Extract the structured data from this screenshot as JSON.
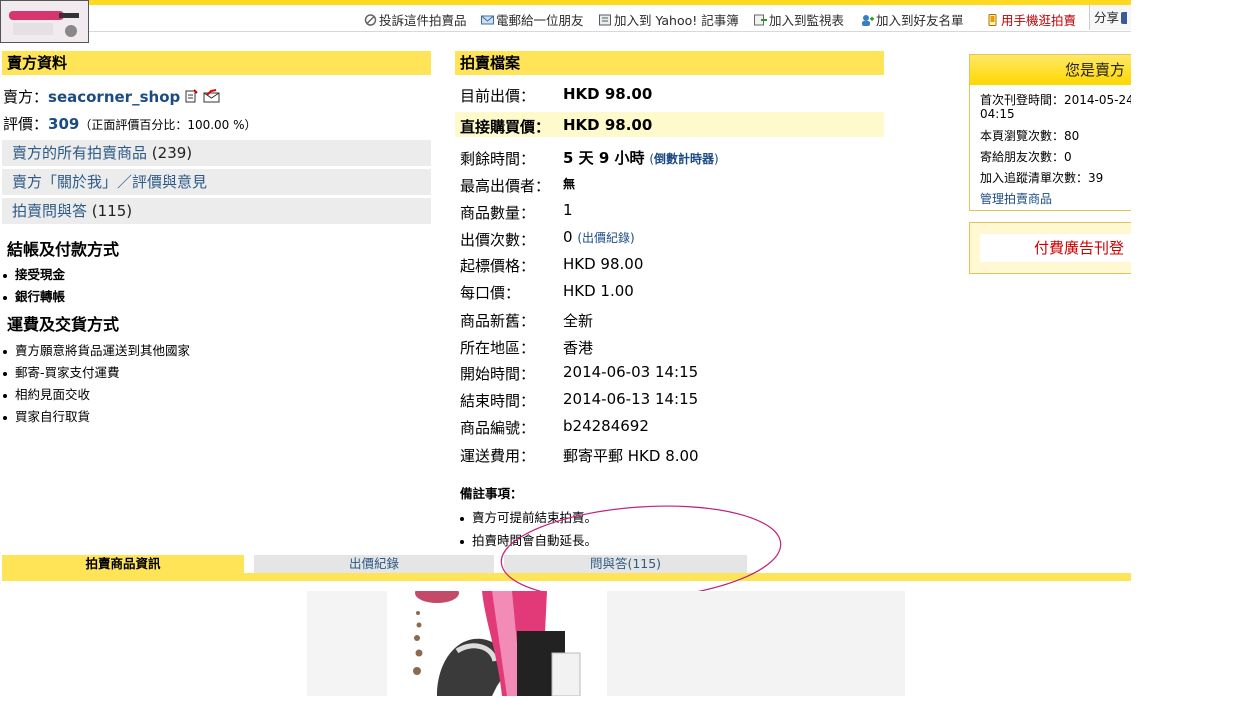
{
  "toolbar": {
    "report": "投訴這件拍賣品",
    "email_friend": "電郵給一位朋友",
    "add_notebook": "加入到 Yahoo! 記事簿",
    "add_watchlist": "加入到監視表",
    "add_friend": "加入到好友名單",
    "mobile_bid": "用手機逛拍賣",
    "share": "分享"
  },
  "seller": {
    "header": "賣方資料",
    "seller_label": "賣方：",
    "seller_name": "seacorner_shop",
    "rating_label": "評價：",
    "rating_value": "309",
    "rating_pct": "（正面評價百分比：100.00 %）",
    "links": [
      {
        "label": "賣方的所有拍賣商品",
        "count": "(239)"
      },
      {
        "label": "賣方「關於我」／評價與意見",
        "count": ""
      },
      {
        "label": "拍賣問與答",
        "count": "(115)"
      }
    ],
    "payment_head": "結帳及付款方式",
    "payment_methods": [
      "接受現金",
      "銀行轉帳"
    ],
    "shipping_head": "運費及交貨方式",
    "shipping_methods": [
      "賣方願意將貨品運送到其他國家",
      "郵寄-買家支付運費",
      "相約見面交收",
      "買家自行取貨"
    ]
  },
  "auction": {
    "header": "拍賣檔案",
    "current_bid_label": "目前出價：",
    "current_bid": "HKD 98.00",
    "buy_now_label": "直接購買價：",
    "buy_now": "HKD 98.00",
    "time_left_label": "剩餘時間：",
    "time_left": "5 天 9 小時",
    "countdown_link": "倒數計時器",
    "high_bidder_label": "最高出價者：",
    "high_bidder": "無",
    "quantity_label": "商品數量：",
    "quantity": "1",
    "bids_label": "出價次數：",
    "bids": "0",
    "bid_history_link": "出價紀錄",
    "start_price_label": "起標價格：",
    "start_price": "HKD 98.00",
    "increment_label": "每口價：",
    "increment": "HKD 1.00",
    "condition_label": "商品新舊：",
    "condition": "全新",
    "location_label": "所在地區：",
    "location": "香港",
    "start_time_label": "開始時間：",
    "start_time": "2014-06-03 14:15",
    "end_time_label": "結束時間：",
    "end_time": "2014-06-13 14:15",
    "item_id_label": "商品編號：",
    "item_id": "b24284692",
    "shipping_label": "運送費用：",
    "shipping": "郵寄平郵 HKD 8.00",
    "notes_head": "備註事項：",
    "notes": [
      "賣方可提前結束拍賣。",
      "拍賣時間會自動延長。"
    ]
  },
  "side": {
    "you_are_seller": "您是賣方",
    "first_listed": "首次刊登時間：2014-05-24",
    "first_listed_time": "04:15",
    "page_views": "本頁瀏覽次數：80",
    "sent_to_friends": "寄給朋友次數：0",
    "tracking": "加入追蹤清單次數：39",
    "manage_link": "管理拍賣商品",
    "paid_ad": "付費廣告刊登"
  },
  "tabs": {
    "info": "拍賣商品資訊",
    "bids": "出價紀錄",
    "qa": "問與答(115)"
  },
  "colors": {
    "accent_yellow": "#ffe457",
    "link_blue": "#1c4b84",
    "annotation_pink": "#c0207a",
    "ad_red": "#d10000"
  }
}
